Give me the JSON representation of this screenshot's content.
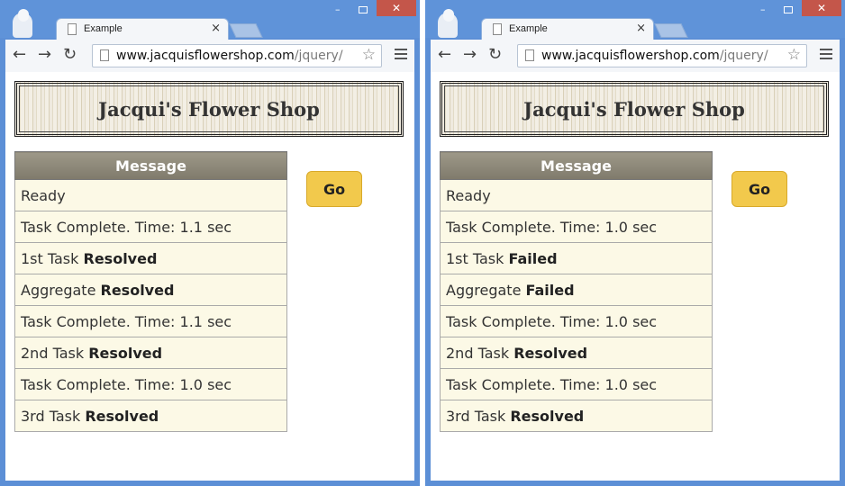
{
  "windows": [
    {
      "tab_title": "Example",
      "url_host": "www.jacquisflowershop.com",
      "url_path": "/jquery/",
      "heading": "Jacqui's Flower Shop",
      "table_header": "Message",
      "go_label": "Go",
      "rows": [
        {
          "text": "Ready",
          "bold": ""
        },
        {
          "text": "Task Complete. Time: 1.1 sec",
          "bold": ""
        },
        {
          "text": "1st Task ",
          "bold": "Resolved"
        },
        {
          "text": "Aggregate ",
          "bold": "Resolved"
        },
        {
          "text": "Task Complete. Time: 1.1 sec",
          "bold": ""
        },
        {
          "text": "2nd Task ",
          "bold": "Resolved"
        },
        {
          "text": "Task Complete. Time: 1.0 sec",
          "bold": ""
        },
        {
          "text": "3rd Task ",
          "bold": "Resolved"
        }
      ]
    },
    {
      "tab_title": "Example",
      "url_host": "www.jacquisflowershop.com",
      "url_path": "/jquery/",
      "heading": "Jacqui's Flower Shop",
      "table_header": "Message",
      "go_label": "Go",
      "rows": [
        {
          "text": "Ready",
          "bold": ""
        },
        {
          "text": "Task Complete. Time: 1.0 sec",
          "bold": ""
        },
        {
          "text": "1st Task ",
          "bold": "Failed"
        },
        {
          "text": "Aggregate ",
          "bold": "Failed"
        },
        {
          "text": "Task Complete. Time: 1.0 sec",
          "bold": ""
        },
        {
          "text": "2nd Task ",
          "bold": "Resolved"
        },
        {
          "text": "Task Complete. Time: 1.0 sec",
          "bold": ""
        },
        {
          "text": "3rd Task ",
          "bold": "Resolved"
        }
      ]
    }
  ],
  "icons": {
    "back": "←",
    "forward": "→",
    "reload": "↻",
    "star": "☆",
    "close": "×",
    "minimize": "–",
    "close_window": "✕"
  },
  "colors": {
    "frame": "#5c8fd6",
    "go_button": "#f2c94c",
    "table_header": "#8f8a7a",
    "row_bg": "#fcf9e6"
  }
}
